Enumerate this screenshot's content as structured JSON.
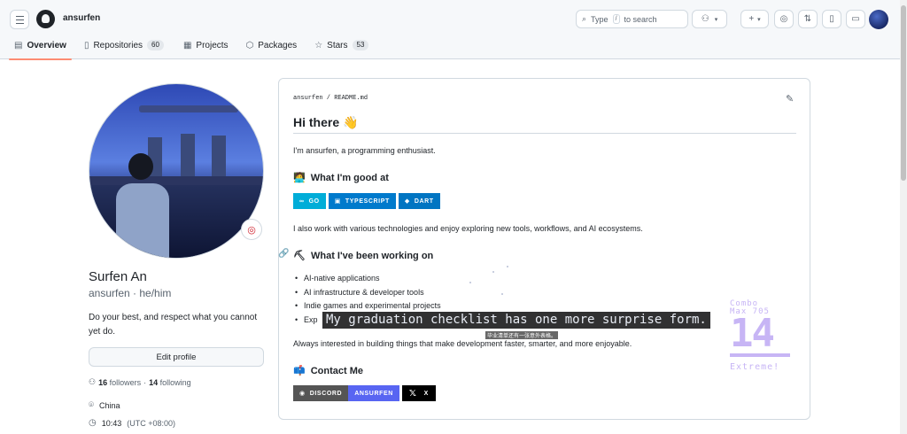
{
  "header": {
    "username": "ansurfen",
    "search_text": "Type",
    "search_key": "/",
    "search_suffix": "to search"
  },
  "tabs": [
    {
      "label": "Overview",
      "icon": "book-icon"
    },
    {
      "label": "Repositories",
      "icon": "repo-icon",
      "count": "60"
    },
    {
      "label": "Projects",
      "icon": "table-icon"
    },
    {
      "label": "Packages",
      "icon": "package-icon"
    },
    {
      "label": "Stars",
      "icon": "star-icon",
      "count": "53"
    }
  ],
  "profile": {
    "name": "Surfen An",
    "login_pronouns": "ansurfen · he/him",
    "bio": "Do your best, and respect what you cannot yet do.",
    "edit_label": "Edit profile",
    "followers_count": "16",
    "followers_label": "followers",
    "following_count": "14",
    "following_label": "following",
    "location": "China",
    "time": "10:43",
    "timezone": "(UTC +08:00)"
  },
  "readme": {
    "path": "ansurfen / README.md",
    "title": "Hi there 👋",
    "intro": "I'm ansurfen, a programming enthusiast.",
    "good_at_heading": "What I'm good at",
    "badges": [
      {
        "label": "GO",
        "color": "#00ADD8"
      },
      {
        "label": "TYPESCRIPT",
        "color": "#007ACC"
      },
      {
        "label": "DART",
        "color": "#0175C2"
      }
    ],
    "tech_paragraph": "I also work with various technologies and enjoy exploring new tools, workflows, and AI ecosystems.",
    "working_heading": "What I've been working on",
    "working_items": [
      "AI-native applications",
      "AI infrastructure & developer tools",
      "Indie games and experimental projects",
      "Exp"
    ],
    "always_paragraph": "Always interested in building things that make development faster, smarter, and more enjoyable.",
    "contact_heading": "Contact Me",
    "contact_badges": {
      "discord_left": "DISCORD",
      "discord_right": "ANSURFEN",
      "x_label": "X"
    }
  },
  "overlay": {
    "subtitle": "My graduation checklist has one more surprise form.",
    "subtitle_small": "毕业清单还有一张意外表格。",
    "combo_label": "Combo",
    "combo_max": "Max 705",
    "combo_value": "14",
    "combo_extra": "Extreme!"
  },
  "colors": {
    "accent_tab": "#fd8c73",
    "discord_left": "#555555",
    "discord_right": "#5865F2",
    "x_badge": "#000000",
    "combo_color": "#c7b5f5"
  }
}
